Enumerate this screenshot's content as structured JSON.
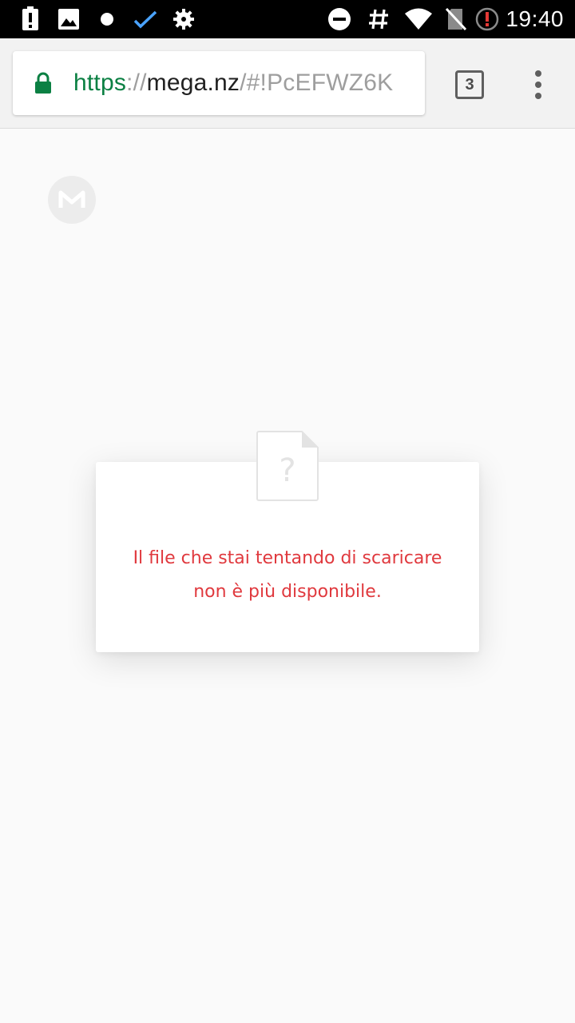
{
  "status_bar": {
    "time": "19:40",
    "left_icons": [
      "alert-icon",
      "image-icon",
      "dot-icon",
      "check-icon",
      "gear-icon"
    ],
    "right_icons": [
      "do-not-disturb-icon",
      "hashtag-icon",
      "wifi-icon",
      "no-sim-icon",
      "battery-alert-icon"
    ]
  },
  "browser": {
    "url_scheme": "https",
    "url_separator": "://",
    "url_host": "mega.nz",
    "url_path": "/#!PcEFWZ6K",
    "tab_count": "3",
    "colors": {
      "secure": "#0b8043",
      "toolbar_bg": "#f2f2f2"
    }
  },
  "page": {
    "logo_letter": "M",
    "file_icon_glyph": "?",
    "error_line_1": "Il file che stai tentando di scaricare",
    "error_line_2": "non è più disponibile.",
    "colors": {
      "error_text": "#e0393e",
      "background": "#fafafa"
    }
  }
}
